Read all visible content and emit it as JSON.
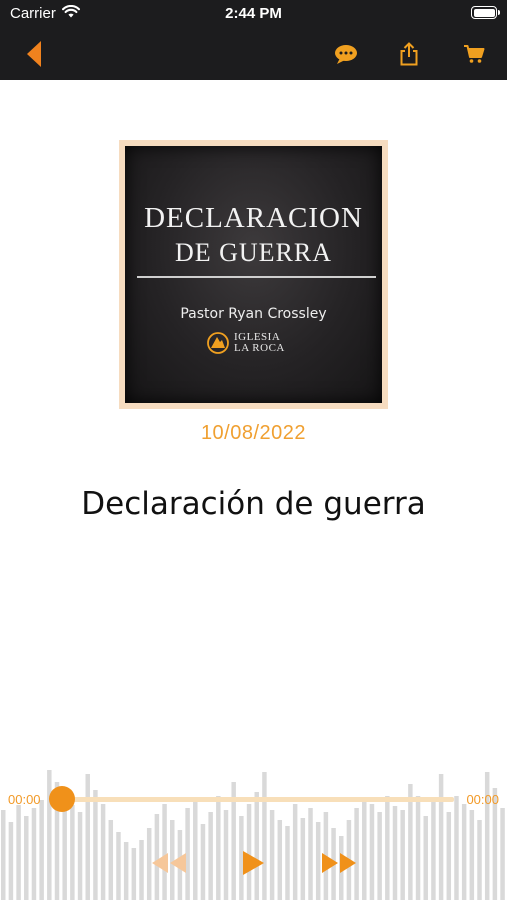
{
  "status_bar": {
    "carrier": "Carrier",
    "time": "2:44 PM"
  },
  "nav": {
    "back_icon": "back-chevron-icon",
    "chat_icon": "chat-bubble-icon",
    "share_icon": "share-icon",
    "cart_icon": "cart-icon",
    "accent_color": "#f0821e"
  },
  "artwork": {
    "line1": "DECLARACION",
    "line2": "DE GUERRA",
    "pastor": "Pastor Ryan Crossley",
    "logo_line1": "IGLESIA",
    "logo_line2": "LA ROCA"
  },
  "sermon": {
    "date": "10/08/2022",
    "title": "Declaración de guerra"
  },
  "player": {
    "elapsed": "00:00",
    "total": "00:00",
    "progress": 0,
    "accent_color": "#f0911a",
    "rewind_icon": "rewind-icon",
    "play_icon": "play-icon",
    "forward_icon": "fast-forward-icon"
  }
}
